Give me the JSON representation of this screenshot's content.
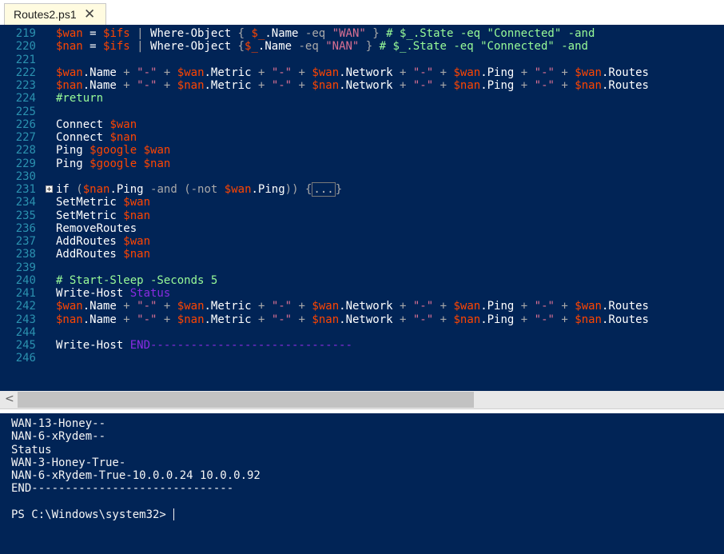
{
  "tab": {
    "title": "Routes2.ps1",
    "close": "✕"
  },
  "editor": {
    "lines": [
      {
        "num": "219",
        "tokens": [
          [
            "v",
            "$wan"
          ],
          [
            "w",
            " = "
          ],
          [
            "v",
            "$ifs"
          ],
          [
            "o",
            " | "
          ],
          [
            "w",
            "Where-Object"
          ],
          [
            "o",
            " { "
          ],
          [
            "v",
            "$_"
          ],
          [
            "w",
            ".Name "
          ],
          [
            "o",
            "-eq"
          ],
          [
            "w",
            " "
          ],
          [
            "s",
            "\"WAN\""
          ],
          [
            "o",
            " }"
          ],
          [
            "c",
            " # $_.State -eq \"Connected\" -and"
          ]
        ]
      },
      {
        "num": "220",
        "tokens": [
          [
            "v",
            "$nan"
          ],
          [
            "w",
            " = "
          ],
          [
            "v",
            "$ifs"
          ],
          [
            "o",
            " | "
          ],
          [
            "w",
            "Where-Object"
          ],
          [
            "o",
            " {"
          ],
          [
            "v",
            "$_"
          ],
          [
            "w",
            ".Name "
          ],
          [
            "o",
            "-eq"
          ],
          [
            "w",
            " "
          ],
          [
            "s",
            "\"NAN\""
          ],
          [
            "o",
            " }"
          ],
          [
            "c",
            " # $_.State -eq \"Connected\" -and"
          ]
        ]
      },
      {
        "num": "221",
        "tokens": []
      },
      {
        "num": "222",
        "tokens": [
          [
            "v",
            "$wan"
          ],
          [
            "w",
            ".Name "
          ],
          [
            "o",
            "+"
          ],
          [
            "w",
            " "
          ],
          [
            "s",
            "\"-\""
          ],
          [
            "w",
            " "
          ],
          [
            "o",
            "+"
          ],
          [
            "w",
            " "
          ],
          [
            "v",
            "$wan"
          ],
          [
            "w",
            ".Metric "
          ],
          [
            "o",
            "+"
          ],
          [
            "w",
            " "
          ],
          [
            "s",
            "\"-\""
          ],
          [
            "w",
            " "
          ],
          [
            "o",
            "+"
          ],
          [
            "w",
            " "
          ],
          [
            "v",
            "$wan"
          ],
          [
            "w",
            ".Network "
          ],
          [
            "o",
            "+"
          ],
          [
            "w",
            " "
          ],
          [
            "s",
            "\"-\""
          ],
          [
            "w",
            " "
          ],
          [
            "o",
            "+"
          ],
          [
            "w",
            " "
          ],
          [
            "v",
            "$wan"
          ],
          [
            "w",
            ".Ping "
          ],
          [
            "o",
            "+"
          ],
          [
            "w",
            " "
          ],
          [
            "s",
            "\"-\""
          ],
          [
            "w",
            " "
          ],
          [
            "o",
            "+"
          ],
          [
            "w",
            " "
          ],
          [
            "v",
            "$wan"
          ],
          [
            "w",
            ".Routes"
          ]
        ]
      },
      {
        "num": "223",
        "tokens": [
          [
            "v",
            "$nan"
          ],
          [
            "w",
            ".Name "
          ],
          [
            "o",
            "+"
          ],
          [
            "w",
            " "
          ],
          [
            "s",
            "\"-\""
          ],
          [
            "w",
            " "
          ],
          [
            "o",
            "+"
          ],
          [
            "w",
            " "
          ],
          [
            "v",
            "$nan"
          ],
          [
            "w",
            ".Metric "
          ],
          [
            "o",
            "+"
          ],
          [
            "w",
            " "
          ],
          [
            "s",
            "\"-\""
          ],
          [
            "w",
            " "
          ],
          [
            "o",
            "+"
          ],
          [
            "w",
            " "
          ],
          [
            "v",
            "$nan"
          ],
          [
            "w",
            ".Network "
          ],
          [
            "o",
            "+"
          ],
          [
            "w",
            " "
          ],
          [
            "s",
            "\"-\""
          ],
          [
            "w",
            " "
          ],
          [
            "o",
            "+"
          ],
          [
            "w",
            " "
          ],
          [
            "v",
            "$nan"
          ],
          [
            "w",
            ".Ping "
          ],
          [
            "o",
            "+"
          ],
          [
            "w",
            " "
          ],
          [
            "s",
            "\"-\""
          ],
          [
            "w",
            " "
          ],
          [
            "o",
            "+"
          ],
          [
            "w",
            " "
          ],
          [
            "v",
            "$nan"
          ],
          [
            "w",
            ".Routes"
          ]
        ]
      },
      {
        "num": "224",
        "tokens": [
          [
            "c",
            "#return"
          ]
        ]
      },
      {
        "num": "225",
        "tokens": []
      },
      {
        "num": "226",
        "tokens": [
          [
            "w",
            "Connect "
          ],
          [
            "v",
            "$wan"
          ]
        ]
      },
      {
        "num": "227",
        "tokens": [
          [
            "w",
            "Connect "
          ],
          [
            "v",
            "$nan"
          ]
        ]
      },
      {
        "num": "228",
        "tokens": [
          [
            "w",
            "Ping "
          ],
          [
            "v",
            "$google"
          ],
          [
            "w",
            " "
          ],
          [
            "v",
            "$wan"
          ]
        ]
      },
      {
        "num": "229",
        "tokens": [
          [
            "w",
            "Ping "
          ],
          [
            "v",
            "$google"
          ],
          [
            "w",
            " "
          ],
          [
            "v",
            "$nan"
          ]
        ]
      },
      {
        "num": "230",
        "tokens": []
      },
      {
        "num": "231",
        "fold": true,
        "tokens": [
          [
            "w",
            "if "
          ],
          [
            "o",
            "("
          ],
          [
            "v",
            "$nan"
          ],
          [
            "w",
            ".Ping "
          ],
          [
            "o",
            "-and"
          ],
          [
            "w",
            " "
          ],
          [
            "o",
            "(-not"
          ],
          [
            "w",
            " "
          ],
          [
            "v",
            "$wan"
          ],
          [
            "w",
            ".Ping"
          ],
          [
            "o",
            "))"
          ],
          [
            "w",
            " "
          ],
          [
            "o",
            "{"
          ],
          [
            "x",
            "..."
          ],
          [
            "o",
            "}"
          ]
        ]
      },
      {
        "num": "234",
        "tokens": [
          [
            "w",
            "SetMetric "
          ],
          [
            "v",
            "$wan"
          ]
        ]
      },
      {
        "num": "235",
        "tokens": [
          [
            "w",
            "SetMetric "
          ],
          [
            "v",
            "$nan"
          ]
        ]
      },
      {
        "num": "236",
        "tokens": [
          [
            "w",
            "RemoveRoutes"
          ]
        ]
      },
      {
        "num": "237",
        "tokens": [
          [
            "w",
            "AddRoutes "
          ],
          [
            "v",
            "$wan"
          ]
        ]
      },
      {
        "num": "238",
        "tokens": [
          [
            "w",
            "AddRoutes "
          ],
          [
            "v",
            "$nan"
          ]
        ]
      },
      {
        "num": "239",
        "tokens": []
      },
      {
        "num": "240",
        "tokens": [
          [
            "c",
            "# Start-Sleep -Seconds 5"
          ]
        ]
      },
      {
        "num": "241",
        "tokens": [
          [
            "w",
            "Write-Host "
          ],
          [
            "a",
            "Status"
          ]
        ]
      },
      {
        "num": "242",
        "tokens": [
          [
            "v",
            "$wan"
          ],
          [
            "w",
            ".Name "
          ],
          [
            "o",
            "+"
          ],
          [
            "w",
            " "
          ],
          [
            "s",
            "\"-\""
          ],
          [
            "w",
            " "
          ],
          [
            "o",
            "+"
          ],
          [
            "w",
            " "
          ],
          [
            "v",
            "$wan"
          ],
          [
            "w",
            ".Metric "
          ],
          [
            "o",
            "+"
          ],
          [
            "w",
            " "
          ],
          [
            "s",
            "\"-\""
          ],
          [
            "w",
            " "
          ],
          [
            "o",
            "+"
          ],
          [
            "w",
            " "
          ],
          [
            "v",
            "$wan"
          ],
          [
            "w",
            ".Network "
          ],
          [
            "o",
            "+"
          ],
          [
            "w",
            " "
          ],
          [
            "s",
            "\"-\""
          ],
          [
            "w",
            " "
          ],
          [
            "o",
            "+"
          ],
          [
            "w",
            " "
          ],
          [
            "v",
            "$wan"
          ],
          [
            "w",
            ".Ping "
          ],
          [
            "o",
            "+"
          ],
          [
            "w",
            " "
          ],
          [
            "s",
            "\"-\""
          ],
          [
            "w",
            " "
          ],
          [
            "o",
            "+"
          ],
          [
            "w",
            " "
          ],
          [
            "v",
            "$wan"
          ],
          [
            "w",
            ".Routes"
          ]
        ]
      },
      {
        "num": "243",
        "tokens": [
          [
            "v",
            "$nan"
          ],
          [
            "w",
            ".Name "
          ],
          [
            "o",
            "+"
          ],
          [
            "w",
            " "
          ],
          [
            "s",
            "\"-\""
          ],
          [
            "w",
            " "
          ],
          [
            "o",
            "+"
          ],
          [
            "w",
            " "
          ],
          [
            "v",
            "$nan"
          ],
          [
            "w",
            ".Metric "
          ],
          [
            "o",
            "+"
          ],
          [
            "w",
            " "
          ],
          [
            "s",
            "\"-\""
          ],
          [
            "w",
            " "
          ],
          [
            "o",
            "+"
          ],
          [
            "w",
            " "
          ],
          [
            "v",
            "$nan"
          ],
          [
            "w",
            ".Network "
          ],
          [
            "o",
            "+"
          ],
          [
            "w",
            " "
          ],
          [
            "s",
            "\"-\""
          ],
          [
            "w",
            " "
          ],
          [
            "o",
            "+"
          ],
          [
            "w",
            " "
          ],
          [
            "v",
            "$nan"
          ],
          [
            "w",
            ".Ping "
          ],
          [
            "o",
            "+"
          ],
          [
            "w",
            " "
          ],
          [
            "s",
            "\"-\""
          ],
          [
            "w",
            " "
          ],
          [
            "o",
            "+"
          ],
          [
            "w",
            " "
          ],
          [
            "v",
            "$nan"
          ],
          [
            "w",
            ".Routes"
          ]
        ]
      },
      {
        "num": "244",
        "tokens": []
      },
      {
        "num": "245",
        "tokens": [
          [
            "w",
            "Write-Host "
          ],
          [
            "a",
            "END------------------------------"
          ]
        ]
      },
      {
        "num": "246",
        "tokens": []
      }
    ]
  },
  "scrollbar": {
    "left_arrow": "<"
  },
  "console": {
    "lines": [
      "WAN-13-Honey--",
      "NAN-6-xRydem--",
      "Status",
      "WAN-3-Honey-True-",
      "NAN-6-xRydem-True-10.0.0.24 10.0.0.92",
      "END------------------------------",
      "",
      "PS C:\\Windows\\system32> "
    ]
  },
  "colors": {
    "background": "#012456",
    "variable": "#ff4500",
    "string": "#db7093",
    "operator": "#a9a9a9",
    "comment": "#98fb98",
    "argument": "#8a2be2",
    "line_number": "#2b91af"
  }
}
